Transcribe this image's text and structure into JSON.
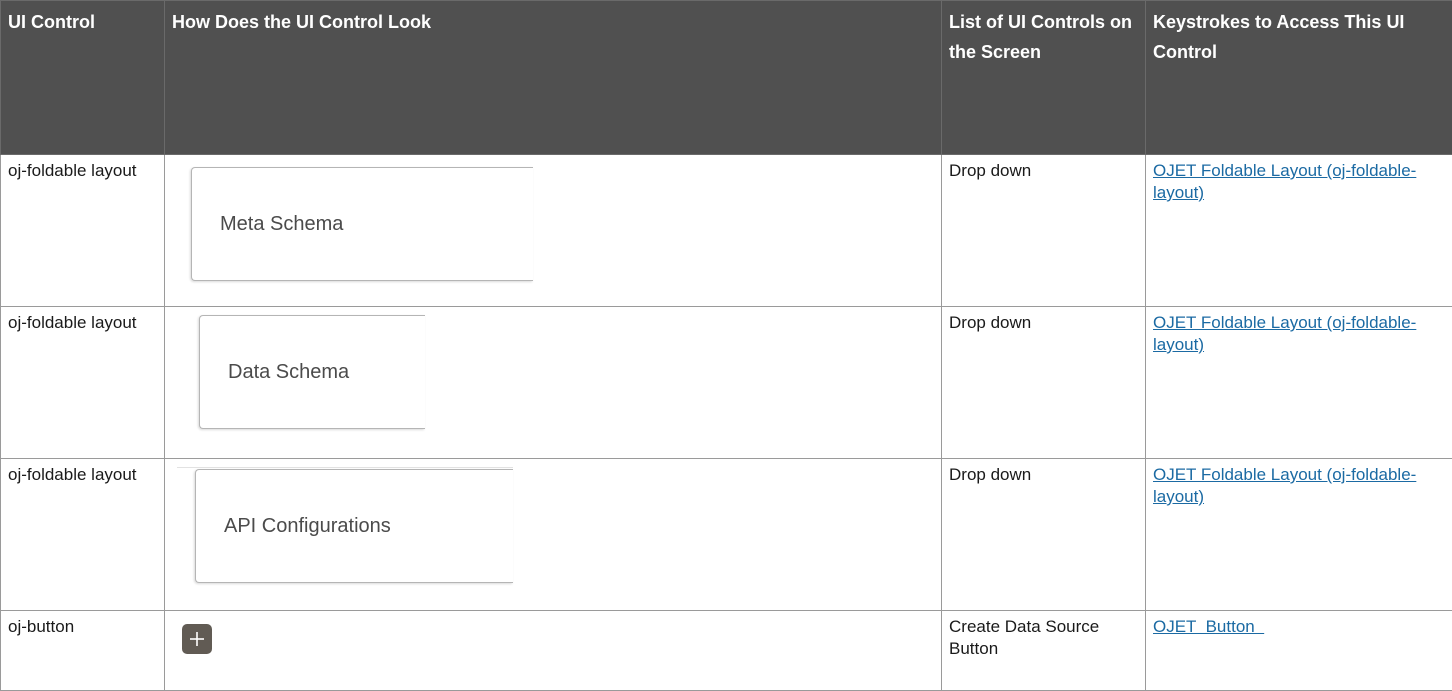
{
  "headers": {
    "col1": "UI Control",
    "col2": "How Does the UI Control Look",
    "col3": "List of UI Controls on the Screen",
    "col4": "Keystrokes to Access This UI Control"
  },
  "rows": [
    {
      "control": "oj-foldable layout",
      "preview_label": "Meta Schema",
      "list": "Drop down",
      "link": "OJET Foldable Layout (oj-foldable-layout)"
    },
    {
      "control": "oj-foldable layout",
      "preview_label": "Data Schema",
      "list": "Drop down",
      "link": "OJET Foldable Layout (oj-foldable-layout)"
    },
    {
      "control": "oj-foldable layout",
      "preview_label": "API Configurations",
      "list": "Drop down",
      "link": "OJET Foldable Layout (oj-foldable-layout)"
    },
    {
      "control": "oj-button",
      "preview_icon": "plus-icon",
      "list": "Create Data Source Button",
      "link": "OJET  Button  "
    }
  ],
  "colors": {
    "header_bg": "#505050",
    "header_text": "#ffffff",
    "link": "#1b6aa3",
    "button_bg": "#615b54"
  }
}
